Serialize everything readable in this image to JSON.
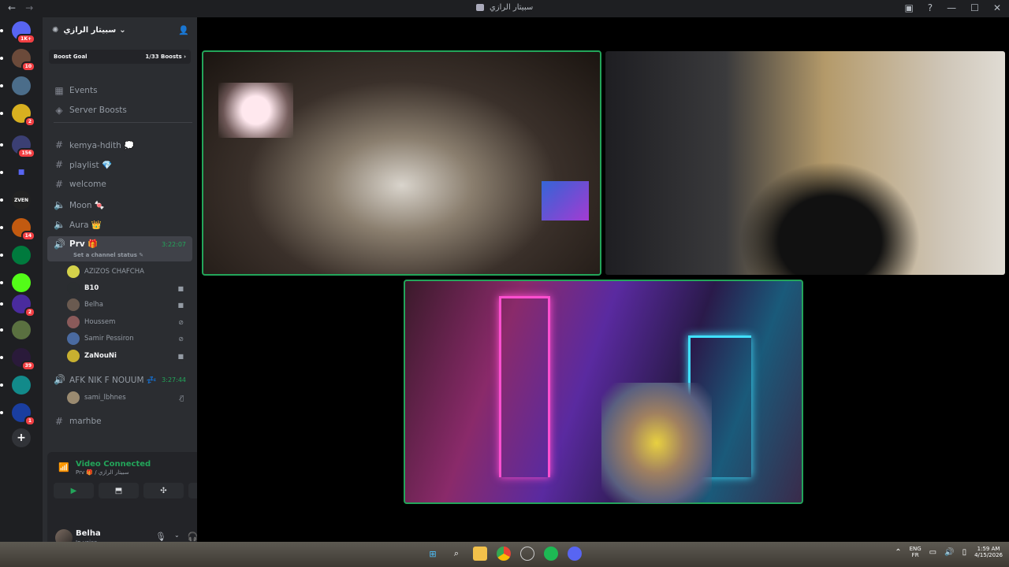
{
  "window": {
    "title": "سبيتار الرازي"
  },
  "guilds": [
    {
      "icon": "discord-logo-icon",
      "badge": "1K+",
      "color": "#5865f2"
    },
    {
      "icon": "server-avatar-1",
      "badge": "10",
      "color": "#6b4a3a"
    },
    {
      "icon": "server-avatar-2",
      "badge": "",
      "color": "#4b6d8a"
    },
    {
      "icon": "server-avatar-3",
      "badge": "2",
      "color": "#d8b020"
    },
    {
      "icon": "server-avatar-4",
      "badge": "156",
      "color": "#3b3f73"
    },
    {
      "icon": "folder-icon",
      "badge": "",
      "color": "#5865f2"
    },
    {
      "icon": "server-avatar-5",
      "label": "ZVEN",
      "badge": "",
      "color": "#222"
    },
    {
      "icon": "server-avatar-6",
      "badge": "14",
      "color": "#c25a10"
    },
    {
      "icon": "palestine-flag-icon",
      "badge": "",
      "color": "#007a3d"
    },
    {
      "icon": "kick-icon",
      "badge": "",
      "color": "#53fc18"
    },
    {
      "icon": "ea-icon",
      "badge": "2",
      "color": "#4a2b9e"
    },
    {
      "icon": "server-avatar-7",
      "badge": "",
      "color": "#5a7040"
    },
    {
      "icon": "server-avatar-8",
      "badge": "39",
      "color": "#2a1a3a"
    },
    {
      "icon": "ea-icon-2",
      "badge": "",
      "color": "#128a8a"
    },
    {
      "icon": "ea-icon-3",
      "badge": "1",
      "color": "#1a3ea0"
    }
  ],
  "server": {
    "name": "سبيتار الرازي",
    "boost_goal_label": "Boost Goal",
    "boost_count": "1/33 Boosts"
  },
  "channels": {
    "events": "Events",
    "server_boosts": "Server Boosts",
    "text": [
      {
        "name": "kemya-hdith 💭"
      },
      {
        "name": "playlist 💎"
      },
      {
        "name": "welcome"
      }
    ],
    "voice": [
      {
        "name": "Moon 🍬"
      },
      {
        "name": "Aura 👑"
      }
    ],
    "active_voice": {
      "name": "Prv 🎁",
      "timer": "3:22:07",
      "status_placeholder": "Set a channel status",
      "users": [
        {
          "name": "AZIZOS CHAFCHA",
          "icon": "",
          "bright": false,
          "color": "#d4d24a"
        },
        {
          "name": "B10",
          "icon": "video-icon",
          "bright": true,
          "color": "#2a2d30"
        },
        {
          "name": "Belha",
          "icon": "video-icon",
          "bright": false,
          "color": "#6a5a50"
        },
        {
          "name": "Houssem",
          "icon": "muted-deafened-icon",
          "bright": false,
          "color": "#8a5a5a"
        },
        {
          "name": "Samir Pessiron",
          "icon": "muted-deafened-icon",
          "bright": false,
          "color": "#4a6aa0"
        },
        {
          "name": "ZaNouNi",
          "icon": "video-icon",
          "bright": true,
          "color": "#c8b030"
        }
      ]
    },
    "afk_voice": {
      "name": "AFK NIK F NOUUM 💤",
      "timer": "3:27:44",
      "users": [
        {
          "name": "sami_lbhnes",
          "icon": "muted-icon",
          "color": "#9a8a70"
        }
      ]
    },
    "bottom": {
      "name": "marhbe"
    }
  },
  "voice_panel": {
    "status": "Video Connected",
    "location": "Prv 🎁 / سبيتار الرازي"
  },
  "user": {
    "name": "Belha",
    "status": "In voice"
  },
  "tray": {
    "lang": "ENG",
    "layout": "FR",
    "time": "1:59 AM",
    "date": "4/15/2026"
  },
  "colors": {
    "accent_green": "#23a55a",
    "badge_red": "#f23f43",
    "sidebar": "#2b2d31",
    "rail": "#1e1f22"
  }
}
